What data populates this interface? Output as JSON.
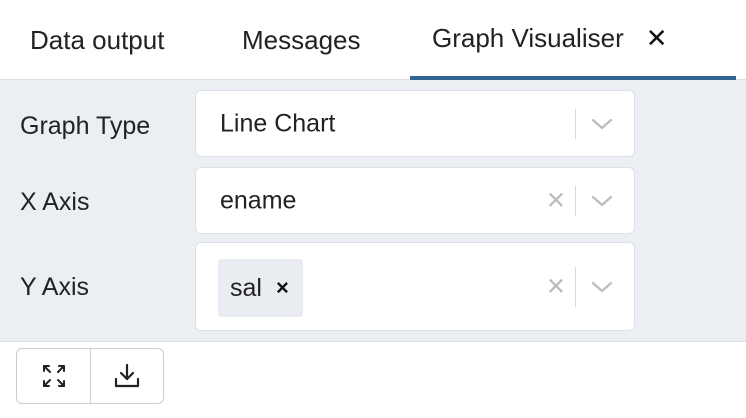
{
  "tabs": [
    {
      "label": "Data output"
    },
    {
      "label": "Messages"
    },
    {
      "label": "Graph Visualiser",
      "close_glyph": "✕"
    }
  ],
  "form": {
    "graph_type": {
      "label": "Graph Type",
      "value": "Line Chart"
    },
    "x_axis": {
      "label": "X Axis",
      "value": "ename",
      "clear_glyph": "✕"
    },
    "y_axis": {
      "label": "Y Axis",
      "chip": "sal",
      "chip_remove_glyph": "×",
      "clear_glyph": "✕"
    }
  },
  "toolbar": {
    "icons": [
      "expand-icon",
      "download-icon"
    ]
  },
  "colors": {
    "active_tab_underline": "#326690",
    "form_background": "#ebeef3",
    "chip_background": "#e9ecf1"
  }
}
